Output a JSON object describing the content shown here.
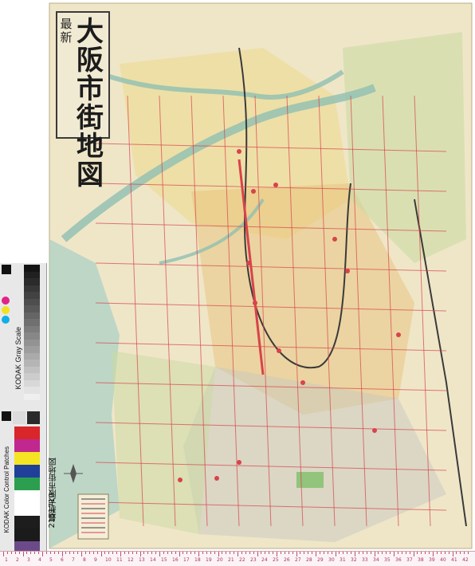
{
  "map": {
    "title_small": "最新",
    "title_main": "大阪市街地図",
    "colors": {
      "paper": "#efe6c8",
      "river": "#8fbfb2",
      "sea": "#a9cfc4",
      "district_yellow": "#ecd98a",
      "district_orange": "#e8c27a",
      "district_green": "#c9d9a0",
      "district_gray": "#c8c8c0",
      "road": "#d8434b",
      "rail": "#3a3a3a"
    },
    "icons": [
      "compass-rose-icon"
    ]
  },
  "color_card": {
    "brand": "KODAK",
    "gray_scale_label": "KODAK Gray Scale",
    "control_label": "KODAK Color Control Patches",
    "id_number": "2151710",
    "id_title": "最新大阪市街地図",
    "patch_colors": [
      "#1d1d1d",
      "#ffffff",
      "#1f3f99",
      "#2b9f4f",
      "#d8262b",
      "#f4e423",
      "#c0288f",
      "#ffffff",
      "#1b1b1b",
      "#6c4a8a"
    ],
    "cmy_dots": [
      "#11aee8",
      "#f0e21e",
      "#e0248a"
    ]
  },
  "ruler": {
    "numbers": [
      "1",
      "2",
      "3",
      "4",
      "5",
      "6",
      "7",
      "8",
      "9",
      "10",
      "11",
      "12",
      "13",
      "14",
      "15",
      "16",
      "17",
      "18",
      "19",
      "20",
      "21",
      "22",
      "23",
      "24",
      "25",
      "26",
      "27",
      "28",
      "29",
      "30",
      "31",
      "32",
      "33",
      "34",
      "35",
      "36",
      "37",
      "38",
      "39",
      "40",
      "41",
      "42"
    ]
  }
}
